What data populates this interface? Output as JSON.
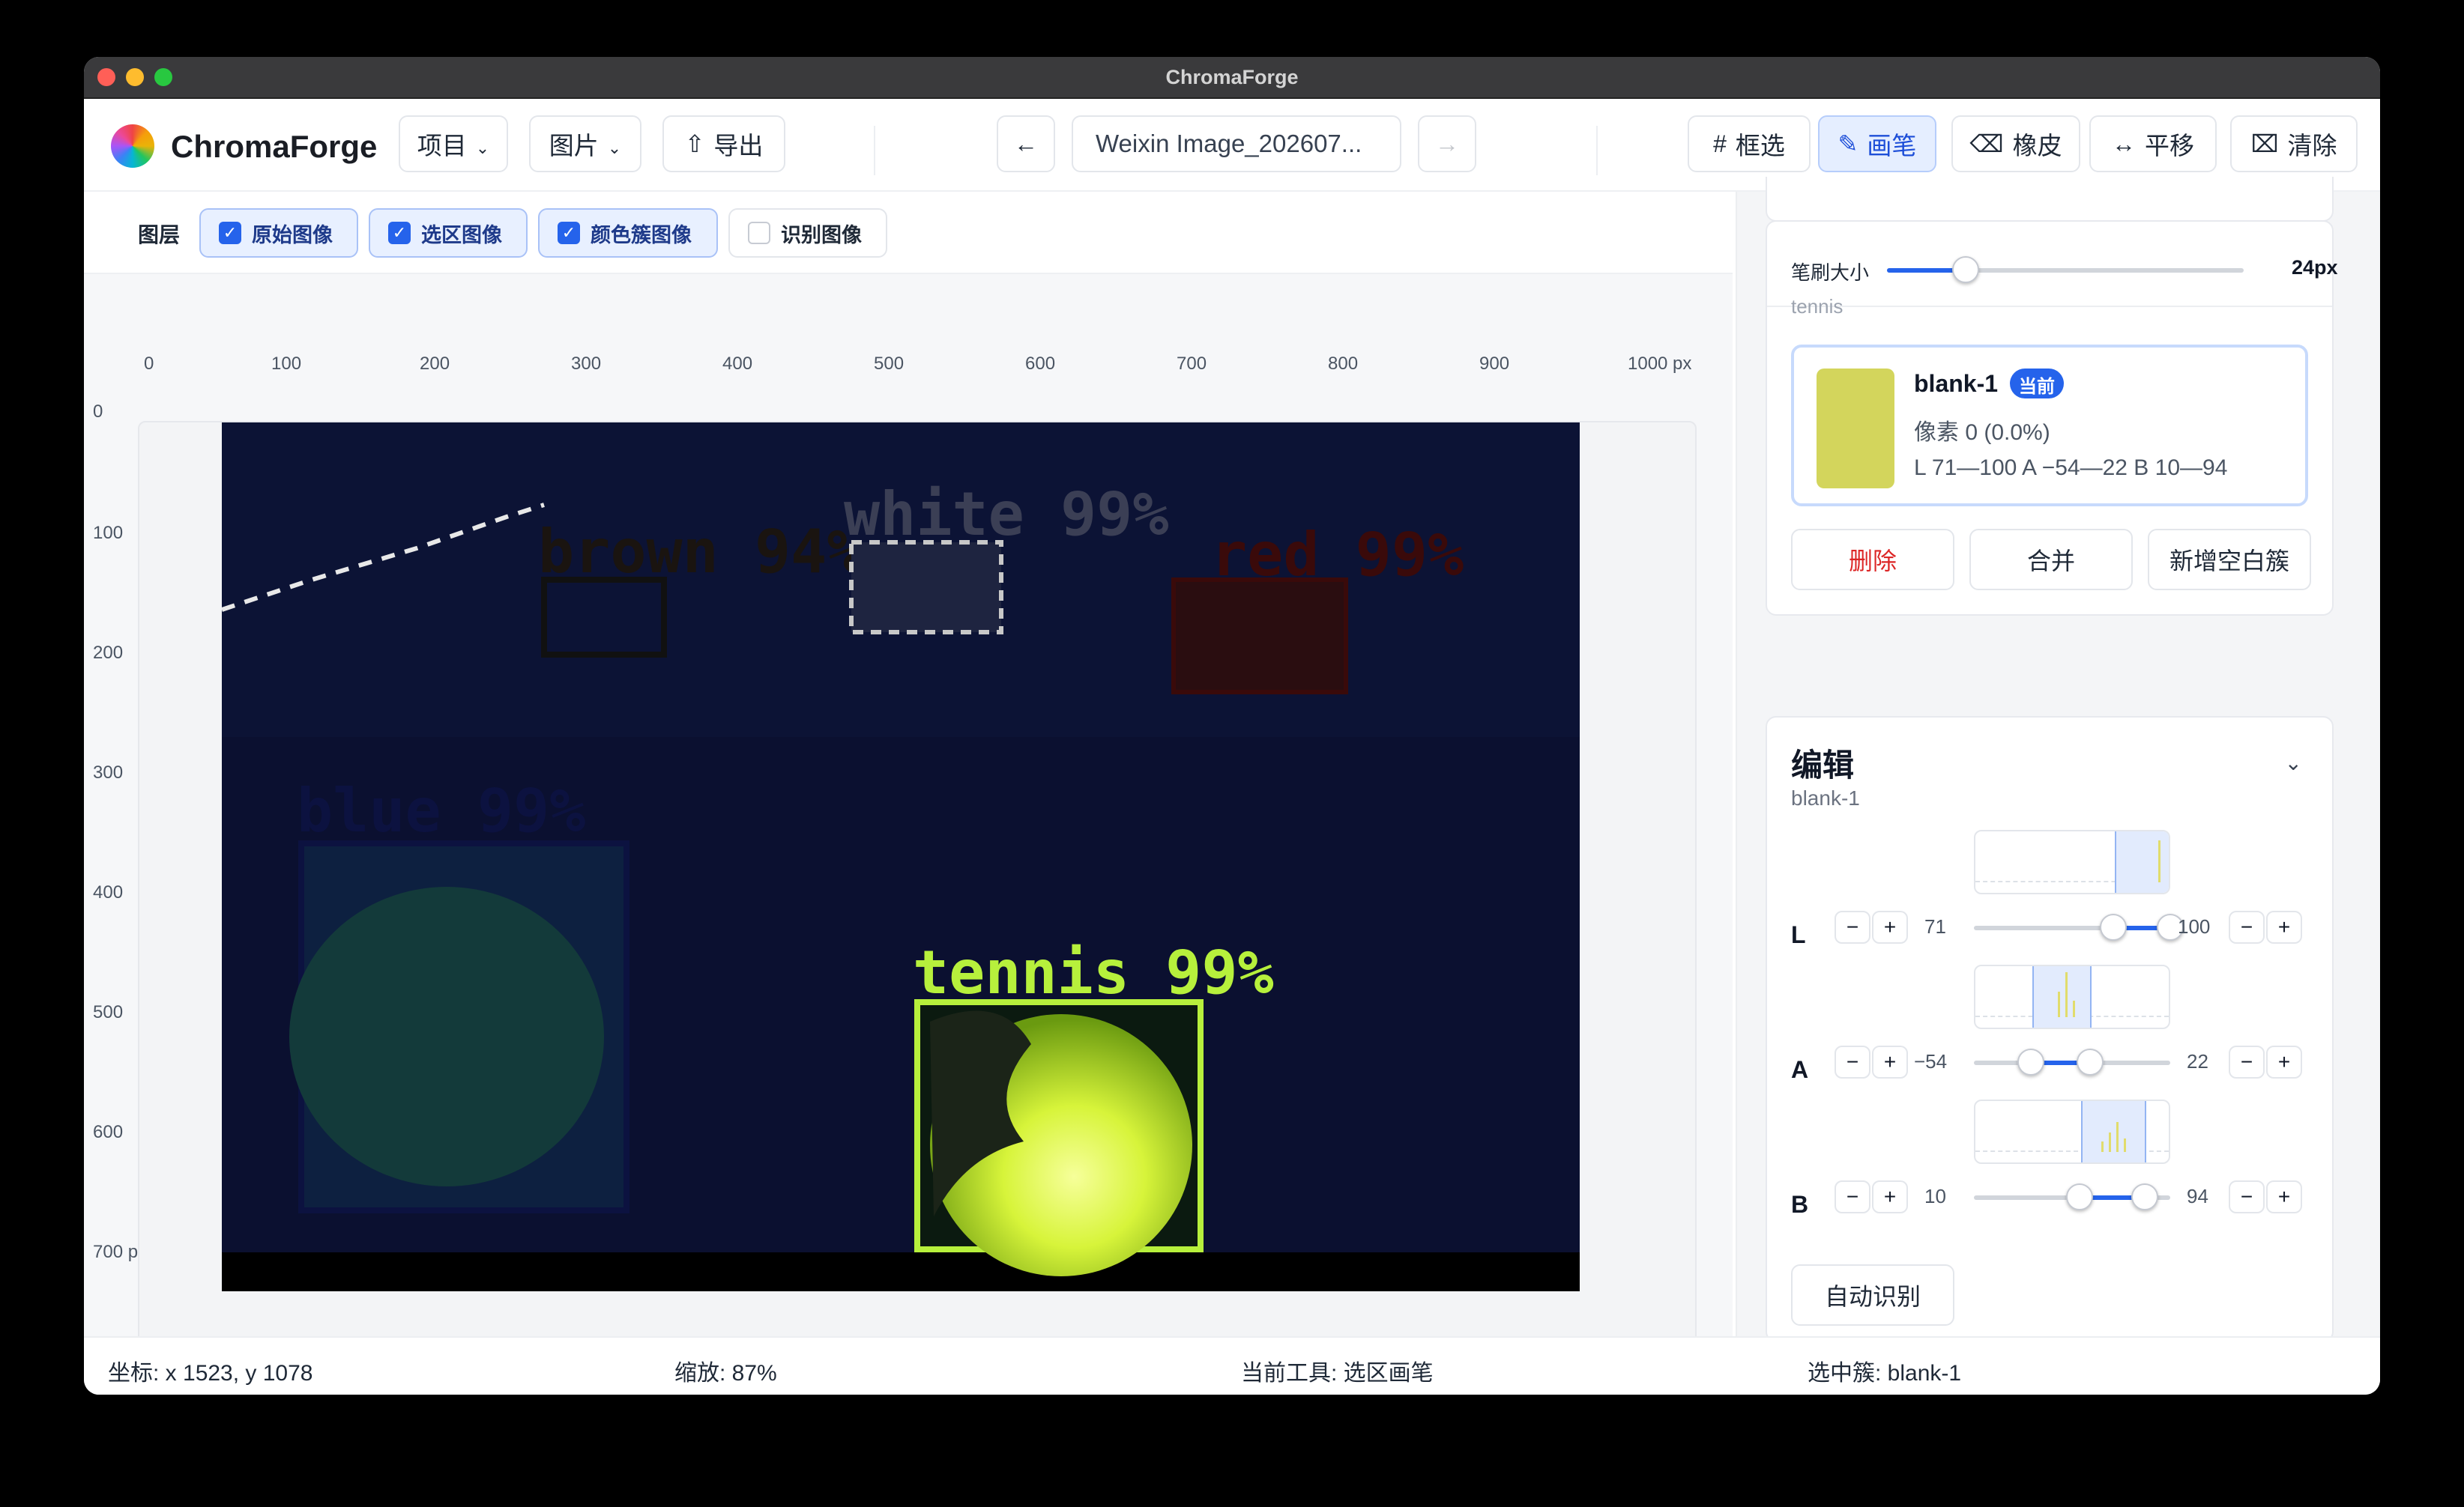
{
  "window": {
    "title": "ChromaForge"
  },
  "app": {
    "name": "ChromaForge"
  },
  "toolbar": {
    "project": "项目",
    "image": "图片",
    "export": "导出",
    "prev_arrow": "←",
    "next_arrow": "→",
    "filename": "Weixin Image_202607...",
    "tools": {
      "box_select": "框选",
      "brush": "画笔",
      "eraser": "橡皮",
      "pan": "平移",
      "clear": "清除"
    },
    "active_tool": "brush"
  },
  "layers": {
    "label": "图层",
    "items": [
      {
        "label": "原始图像",
        "checked": true
      },
      {
        "label": "选区图像",
        "checked": true
      },
      {
        "label": "颜色簇图像",
        "checked": true
      },
      {
        "label": "识别图像",
        "checked": false
      }
    ]
  },
  "ruler": {
    "x": [
      "0",
      "100",
      "200",
      "300",
      "400",
      "500",
      "600",
      "700",
      "800",
      "900",
      "1000 px"
    ],
    "y": [
      "0",
      "100",
      "200",
      "300",
      "400",
      "500",
      "600",
      "700 p"
    ]
  },
  "detections": [
    {
      "label": "brown 94%",
      "color": "#1a1410"
    },
    {
      "label": "white 99%",
      "color": "#e5e7eb"
    },
    {
      "label": "red 99%",
      "color": "#3a0a0a"
    },
    {
      "label": "blue 99%",
      "color": "#0c1240"
    },
    {
      "label": "tennis 99%",
      "color": "#b7f03c"
    }
  ],
  "sidebar": {
    "brush_size_label": "笔刷大小",
    "brush_size_value": "24px",
    "brush_size_fraction": 0.22,
    "group_label_cut": "tennis",
    "cluster": {
      "name": "blank-1",
      "badge": "当前",
      "pixels": "像素 0 (0.0%)",
      "range": "L 71—100 A −54—22 B 10—94",
      "swatch_color": "#d3d55c"
    },
    "actions": {
      "delete": "删除",
      "merge": "合并",
      "add_empty": "新增空白簇"
    },
    "edit": {
      "title": "编辑",
      "subtitle": "blank-1",
      "channels": [
        {
          "name": "L",
          "min": "71",
          "max": "100",
          "lo": 0.71,
          "hi": 1.0
        },
        {
          "name": "A",
          "min": "−54",
          "max": "22",
          "lo": 0.29,
          "hi": 0.59
        },
        {
          "name": "B",
          "min": "10",
          "max": "94",
          "lo": 0.54,
          "hi": 0.87
        }
      ],
      "minus": "−",
      "plus": "+",
      "auto": "自动识别"
    }
  },
  "status": {
    "coords": "坐标: x 1523, y 1078",
    "zoom": "缩放: 87%",
    "tool": "当前工具: 选区画笔",
    "selected": "选中簇: blank-1"
  },
  "colors": {
    "accent": "#2563eb",
    "danger": "#dc2626"
  }
}
